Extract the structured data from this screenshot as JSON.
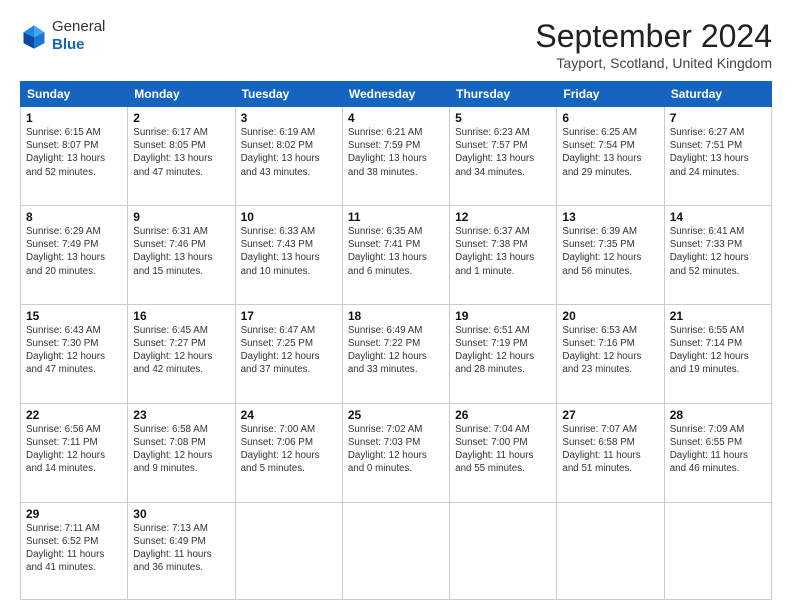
{
  "header": {
    "logo_general": "General",
    "logo_blue": "Blue",
    "month": "September 2024",
    "location": "Tayport, Scotland, United Kingdom"
  },
  "days_of_week": [
    "Sunday",
    "Monday",
    "Tuesday",
    "Wednesday",
    "Thursday",
    "Friday",
    "Saturday"
  ],
  "weeks": [
    [
      {
        "day": "1",
        "lines": [
          "Sunrise: 6:15 AM",
          "Sunset: 8:07 PM",
          "Daylight: 13 hours",
          "and 52 minutes."
        ]
      },
      {
        "day": "2",
        "lines": [
          "Sunrise: 6:17 AM",
          "Sunset: 8:05 PM",
          "Daylight: 13 hours",
          "and 47 minutes."
        ]
      },
      {
        "day": "3",
        "lines": [
          "Sunrise: 6:19 AM",
          "Sunset: 8:02 PM",
          "Daylight: 13 hours",
          "and 43 minutes."
        ]
      },
      {
        "day": "4",
        "lines": [
          "Sunrise: 6:21 AM",
          "Sunset: 7:59 PM",
          "Daylight: 13 hours",
          "and 38 minutes."
        ]
      },
      {
        "day": "5",
        "lines": [
          "Sunrise: 6:23 AM",
          "Sunset: 7:57 PM",
          "Daylight: 13 hours",
          "and 34 minutes."
        ]
      },
      {
        "day": "6",
        "lines": [
          "Sunrise: 6:25 AM",
          "Sunset: 7:54 PM",
          "Daylight: 13 hours",
          "and 29 minutes."
        ]
      },
      {
        "day": "7",
        "lines": [
          "Sunrise: 6:27 AM",
          "Sunset: 7:51 PM",
          "Daylight: 13 hours",
          "and 24 minutes."
        ]
      }
    ],
    [
      {
        "day": "8",
        "lines": [
          "Sunrise: 6:29 AM",
          "Sunset: 7:49 PM",
          "Daylight: 13 hours",
          "and 20 minutes."
        ]
      },
      {
        "day": "9",
        "lines": [
          "Sunrise: 6:31 AM",
          "Sunset: 7:46 PM",
          "Daylight: 13 hours",
          "and 15 minutes."
        ]
      },
      {
        "day": "10",
        "lines": [
          "Sunrise: 6:33 AM",
          "Sunset: 7:43 PM",
          "Daylight: 13 hours",
          "and 10 minutes."
        ]
      },
      {
        "day": "11",
        "lines": [
          "Sunrise: 6:35 AM",
          "Sunset: 7:41 PM",
          "Daylight: 13 hours",
          "and 6 minutes."
        ]
      },
      {
        "day": "12",
        "lines": [
          "Sunrise: 6:37 AM",
          "Sunset: 7:38 PM",
          "Daylight: 13 hours",
          "and 1 minute."
        ]
      },
      {
        "day": "13",
        "lines": [
          "Sunrise: 6:39 AM",
          "Sunset: 7:35 PM",
          "Daylight: 12 hours",
          "and 56 minutes."
        ]
      },
      {
        "day": "14",
        "lines": [
          "Sunrise: 6:41 AM",
          "Sunset: 7:33 PM",
          "Daylight: 12 hours",
          "and 52 minutes."
        ]
      }
    ],
    [
      {
        "day": "15",
        "lines": [
          "Sunrise: 6:43 AM",
          "Sunset: 7:30 PM",
          "Daylight: 12 hours",
          "and 47 minutes."
        ]
      },
      {
        "day": "16",
        "lines": [
          "Sunrise: 6:45 AM",
          "Sunset: 7:27 PM",
          "Daylight: 12 hours",
          "and 42 minutes."
        ]
      },
      {
        "day": "17",
        "lines": [
          "Sunrise: 6:47 AM",
          "Sunset: 7:25 PM",
          "Daylight: 12 hours",
          "and 37 minutes."
        ]
      },
      {
        "day": "18",
        "lines": [
          "Sunrise: 6:49 AM",
          "Sunset: 7:22 PM",
          "Daylight: 12 hours",
          "and 33 minutes."
        ]
      },
      {
        "day": "19",
        "lines": [
          "Sunrise: 6:51 AM",
          "Sunset: 7:19 PM",
          "Daylight: 12 hours",
          "and 28 minutes."
        ]
      },
      {
        "day": "20",
        "lines": [
          "Sunrise: 6:53 AM",
          "Sunset: 7:16 PM",
          "Daylight: 12 hours",
          "and 23 minutes."
        ]
      },
      {
        "day": "21",
        "lines": [
          "Sunrise: 6:55 AM",
          "Sunset: 7:14 PM",
          "Daylight: 12 hours",
          "and 19 minutes."
        ]
      }
    ],
    [
      {
        "day": "22",
        "lines": [
          "Sunrise: 6:56 AM",
          "Sunset: 7:11 PM",
          "Daylight: 12 hours",
          "and 14 minutes."
        ]
      },
      {
        "day": "23",
        "lines": [
          "Sunrise: 6:58 AM",
          "Sunset: 7:08 PM",
          "Daylight: 12 hours",
          "and 9 minutes."
        ]
      },
      {
        "day": "24",
        "lines": [
          "Sunrise: 7:00 AM",
          "Sunset: 7:06 PM",
          "Daylight: 12 hours",
          "and 5 minutes."
        ]
      },
      {
        "day": "25",
        "lines": [
          "Sunrise: 7:02 AM",
          "Sunset: 7:03 PM",
          "Daylight: 12 hours",
          "and 0 minutes."
        ]
      },
      {
        "day": "26",
        "lines": [
          "Sunrise: 7:04 AM",
          "Sunset: 7:00 PM",
          "Daylight: 11 hours",
          "and 55 minutes."
        ]
      },
      {
        "day": "27",
        "lines": [
          "Sunrise: 7:07 AM",
          "Sunset: 6:58 PM",
          "Daylight: 11 hours",
          "and 51 minutes."
        ]
      },
      {
        "day": "28",
        "lines": [
          "Sunrise: 7:09 AM",
          "Sunset: 6:55 PM",
          "Daylight: 11 hours",
          "and 46 minutes."
        ]
      }
    ],
    [
      {
        "day": "29",
        "lines": [
          "Sunrise: 7:11 AM",
          "Sunset: 6:52 PM",
          "Daylight: 11 hours",
          "and 41 minutes."
        ]
      },
      {
        "day": "30",
        "lines": [
          "Sunrise: 7:13 AM",
          "Sunset: 6:49 PM",
          "Daylight: 11 hours",
          "and 36 minutes."
        ]
      },
      {
        "day": "",
        "lines": []
      },
      {
        "day": "",
        "lines": []
      },
      {
        "day": "",
        "lines": []
      },
      {
        "day": "",
        "lines": []
      },
      {
        "day": "",
        "lines": []
      }
    ]
  ]
}
